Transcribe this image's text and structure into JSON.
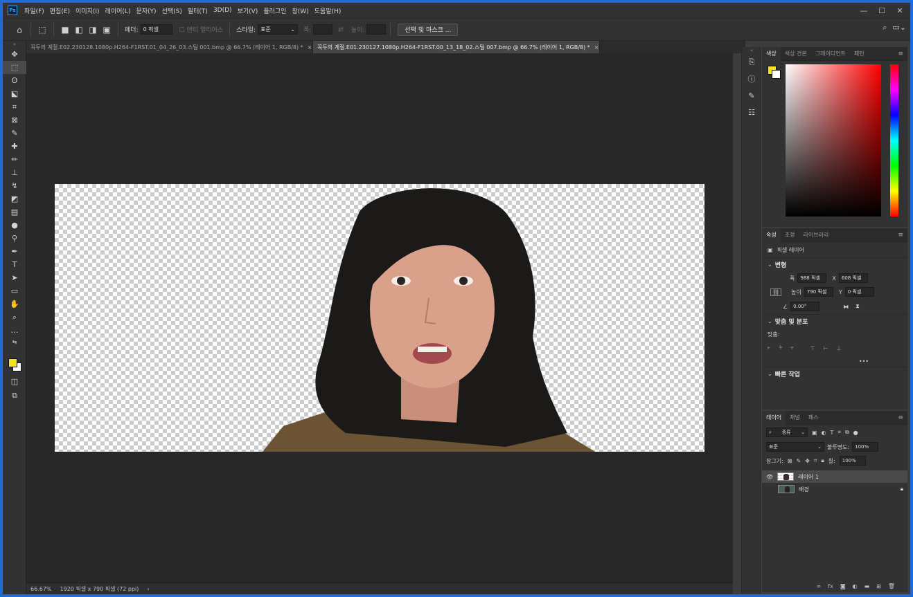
{
  "app": {
    "logo": "Ps"
  },
  "menu": [
    "파일(F)",
    "편집(E)",
    "이미지(I)",
    "레이어(L)",
    "문자(Y)",
    "선택(S)",
    "필터(T)",
    "3D(D)",
    "보기(V)",
    "플러그인",
    "창(W)",
    "도움말(H)"
  ],
  "options": {
    "feather_label": "페더:",
    "feather_value": "0 픽셀",
    "antialias_label": "앤티 앨리어스",
    "style_label": "스타일:",
    "style_value": "표준",
    "width_label": "폭:",
    "height_label": "높이:",
    "select_mask_button": "선택 및 마스크 ..."
  },
  "tabs": [
    {
      "label": "꼭두의 계절.E02.230128.1080p.H264-F1RST.01_04_26_03.스틸 001.bmp @ 66.7% (레이어 1, RGB/8) *",
      "close": "×"
    },
    {
      "label": "꼭두의 계절.E01.230127.1080p.H264-F1RST.00_13_18_02.스틸 007.bmp @ 66.7% (레이어 1, RGB/8) *",
      "close": "×"
    }
  ],
  "colors": {
    "foreground": "#f4e21a",
    "background": "#ffffff"
  },
  "status": {
    "zoom": "66.67%",
    "doc_info": "1920 픽셀 x 790 픽셀 (72 ppi)",
    "arrow": "›"
  },
  "color_panel": {
    "tabs": [
      "색상",
      "색상 견본",
      "그레이디언트",
      "패턴"
    ]
  },
  "properties_panel": {
    "tabs": [
      "속성",
      "조정",
      "라이브러리"
    ],
    "layer_type": "픽셀 레이어",
    "transform_header": "변형",
    "w_label": "폭",
    "w_value": "988 픽셀",
    "x_label": "X",
    "x_value": "608 픽셀",
    "h_label": "높이",
    "h_value": "790 픽셀",
    "y_label": "Y",
    "y_value": "0 픽셀",
    "angle_value": "0.00°",
    "align_header": "맞춤 및 분포",
    "align_label": "맞춤:",
    "more": "•••",
    "quick_header": "빠른 작업"
  },
  "layers_panel": {
    "tabs": [
      "레이어",
      "채널",
      "패스"
    ],
    "filter_kind": "종류",
    "blend_mode": "표준",
    "opacity_label": "불투명도:",
    "opacity_value": "100%",
    "lock_label": "잠그기:",
    "fill_label": "칠:",
    "fill_value": "100%",
    "layers": [
      {
        "name": "레이어 1",
        "visible": true,
        "selected": true
      },
      {
        "name": "배경",
        "visible": false,
        "locked": true
      }
    ]
  }
}
